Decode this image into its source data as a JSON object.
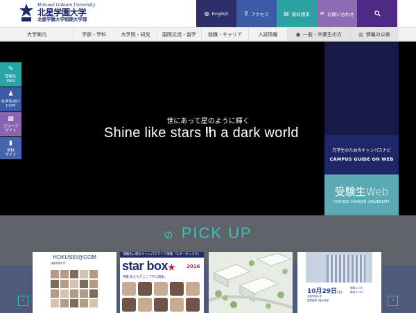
{
  "header": {
    "logo_en": "Hokusei Gakuen University",
    "logo_main": "北星学園大学",
    "logo_sub": "北星学園大学短期大学部",
    "buttons": [
      {
        "label": "English",
        "icon": "globe-icon"
      },
      {
        "label": "アクセス",
        "icon": "map-pin-icon"
      },
      {
        "label": "資料請求",
        "icon": "document-icon"
      },
      {
        "label": "お問い合わせ",
        "icon": "mail-icon"
      },
      {
        "label": "",
        "icon": "search-icon"
      }
    ]
  },
  "nav": {
    "items": [
      "大学案内",
      "学部・学科",
      "大学院・研究",
      "国際交流・留学",
      "就職・キャリア",
      "入試情報",
      "一般・卒業生の方",
      "情報の公表"
    ]
  },
  "hero": {
    "subtitle": "世にあって星のように輝く",
    "title": "Shine like stars in a dark world",
    "pause_symbol": "II"
  },
  "hero_side": {
    "campus_line1": "在学生のためのキャンパスナビ",
    "campus_line2": "CAMPUS GUIDE ON WEB",
    "juken_main": "受験生Web",
    "juken_sub": "HOKUSEI GAKUEN UNIVERSITY"
  },
  "side_tabs": [
    {
      "label_1": "受験生",
      "label_2": "Web",
      "icon": "user-icon"
    },
    {
      "label_1": "在学生向け",
      "label_2": "COW",
      "icon": "student-icon"
    },
    {
      "label_1": "グループ",
      "label_2": "サイト",
      "icon": "grid-icon"
    },
    {
      "label_1": "学科",
      "label_2": "サイト",
      "icon": "book-icon"
    }
  ],
  "pickup": {
    "title": "PICK UP",
    "prev": "‹",
    "next": "›",
    "cards": [
      {
        "title": "HOKUSEI@COM",
        "sub": "北星学園大学"
      },
      {
        "top": "受験生に贈るキャンパスライフ情報「スターボックス」",
        "brand": "star",
        "brand2": "box",
        "star": "★",
        "year": "2016",
        "tag": "特集 私たちがここで学ぶ理由。"
      },
      {
        "label": ""
      },
      {
        "date": "10月29日",
        "date_small": "(土)",
        "line1": "北星学園大学",
        "line2": "図書館棟 4階大教室",
        "side1": "開場 13:00",
        "side2": "開演 13:30"
      }
    ]
  },
  "colors": {
    "brand_navy": "#1d2a6b",
    "teal": "#37c3c5",
    "english_btn": "#2d2f6a",
    "access_btn": "#3c5ba7",
    "doc_btn": "#2fa1a3",
    "ask_btn": "#8f6bb1",
    "search_btn": "#4e2a84"
  }
}
